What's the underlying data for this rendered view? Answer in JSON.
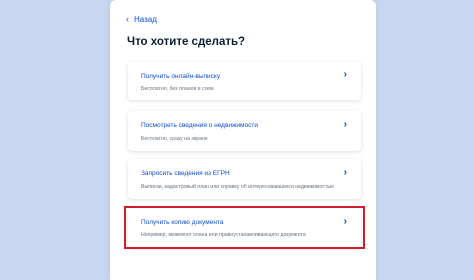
{
  "back_label": "Назад",
  "page_title": "Что хотите сделать?",
  "options": [
    {
      "label": "Получить онлайн-выписку",
      "description": "Бесплатно, без планов и схем"
    },
    {
      "label": "Посмотреть сведения о недвижимости",
      "description": "Бесплатно, сразу на экране"
    },
    {
      "label": "Запросить сведения из ЕГРН",
      "description": "Выписки, кадастровый план или справку об интересовавшихся недвижимостью"
    },
    {
      "label": "Получить копию документа",
      "description": "Например, межевого плана или правоустанавливающего документа"
    }
  ],
  "colors": {
    "accent": "#0d4cd3",
    "background": "#c7d6ee",
    "highlight": "#cc1f2e"
  },
  "icons": {
    "back": "chevron-left-icon",
    "option_arrow": "chevron-right-icon"
  }
}
